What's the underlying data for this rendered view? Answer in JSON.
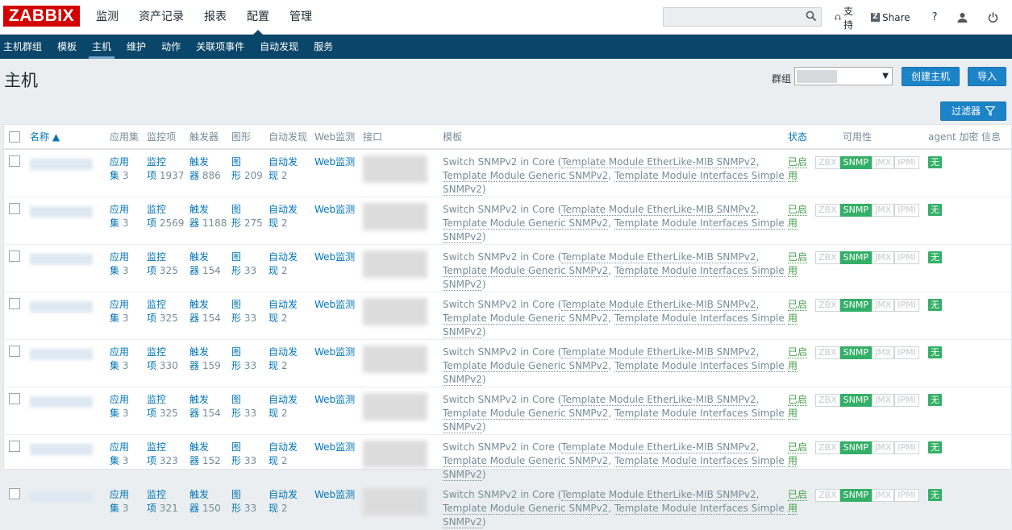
{
  "logo": "ZABBIX",
  "main_menu": [
    "监测",
    "资产记录",
    "报表",
    "配置",
    "管理"
  ],
  "top_links": {
    "support": "支持",
    "share": "Share",
    "help": "?"
  },
  "search": {
    "placeholder": ""
  },
  "sub_menu": [
    "主机群组",
    "模板",
    "主机",
    "维护",
    "动作",
    "关联项事件",
    "自动发现",
    "服务"
  ],
  "page": {
    "title": "主机",
    "group_label": "群组",
    "create_button": "创建主机",
    "import_button": "导入",
    "filter_button": "过滤器"
  },
  "columns": [
    "名称 ▲",
    "应用集",
    "监控项",
    "触发器",
    "图形",
    "自动发现",
    "Web监测",
    "接口",
    "模板",
    "状态",
    "可用性",
    "agent 加密",
    "信息"
  ],
  "availability_labels": [
    "ZBX",
    "SNMP",
    "JMX",
    "IPMI"
  ],
  "row_common": {
    "app_label_a": "应用",
    "app_label_b": "集",
    "item_label_a": "监控",
    "item_label_b": "项",
    "trig_label_a": "触发",
    "trig_label_b": "器",
    "graph_label_a": "图",
    "graph_label_b": "形",
    "disc_label_a": "自动发",
    "disc_label_b": "现",
    "web_label": "Web监测",
    "template_main": "Switch SNMPv2 in Core",
    "template_links": [
      "Template Module EtherLike-MIB SNMPv2",
      "Template Module Generic SNMPv2",
      "Template Module Interfaces Simple SNMPv2"
    ],
    "status_a": "已启",
    "status_b": "用",
    "encryption": "无"
  },
  "rows": [
    {
      "apps": "3",
      "items": "1937",
      "triggers": "886",
      "graphs": "209",
      "discovery": "2"
    },
    {
      "apps": "3",
      "items": "2569",
      "triggers": "1188",
      "graphs": "275",
      "discovery": "2"
    },
    {
      "apps": "3",
      "items": "325",
      "triggers": "154",
      "graphs": "33",
      "discovery": "2"
    },
    {
      "apps": "3",
      "items": "325",
      "triggers": "154",
      "graphs": "33",
      "discovery": "2"
    },
    {
      "apps": "3",
      "items": "330",
      "triggers": "159",
      "graphs": "33",
      "discovery": "2"
    },
    {
      "apps": "3",
      "items": "325",
      "triggers": "154",
      "graphs": "33",
      "discovery": "2"
    },
    {
      "apps": "3",
      "items": "323",
      "triggers": "152",
      "graphs": "33",
      "discovery": "2"
    },
    {
      "apps": "3",
      "items": "321",
      "triggers": "150",
      "graphs": "33",
      "discovery": "2"
    }
  ],
  "colors": {
    "brand": "#d40000",
    "nav": "#0a466a",
    "link": "#0275b8",
    "enabled": "#429e47",
    "badge": "#34af67",
    "button": "#1c83c7"
  }
}
